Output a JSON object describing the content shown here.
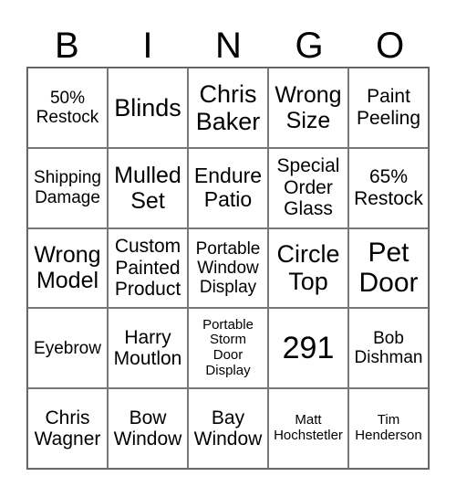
{
  "header": [
    "B",
    "I",
    "N",
    "G",
    "O"
  ],
  "cells": [
    [
      "50%\nRestock",
      "Blinds",
      "Chris\nBaker",
      "Wrong\nSize",
      "Paint\nPeeling"
    ],
    [
      "Shipping\nDamage",
      "Mulled\nSet",
      "Endure\nPatio",
      "Special\nOrder\nGlass",
      "65%\nRestock"
    ],
    [
      "Wrong\nModel",
      "Custom\nPainted\nProduct",
      "Portable\nWindow\nDisplay",
      "Circle\nTop",
      "Pet\nDoor"
    ],
    [
      "Eyebrow",
      "Harry\nMoutlon",
      "Portable\nStorm\nDoor\nDisplay",
      "291",
      "Bob\nDishman"
    ],
    [
      "Chris\nWagner",
      "Bow\nWindow",
      "Bay\nWindow",
      "Matt\nHochstetler",
      "Tim\nHenderson"
    ]
  ]
}
